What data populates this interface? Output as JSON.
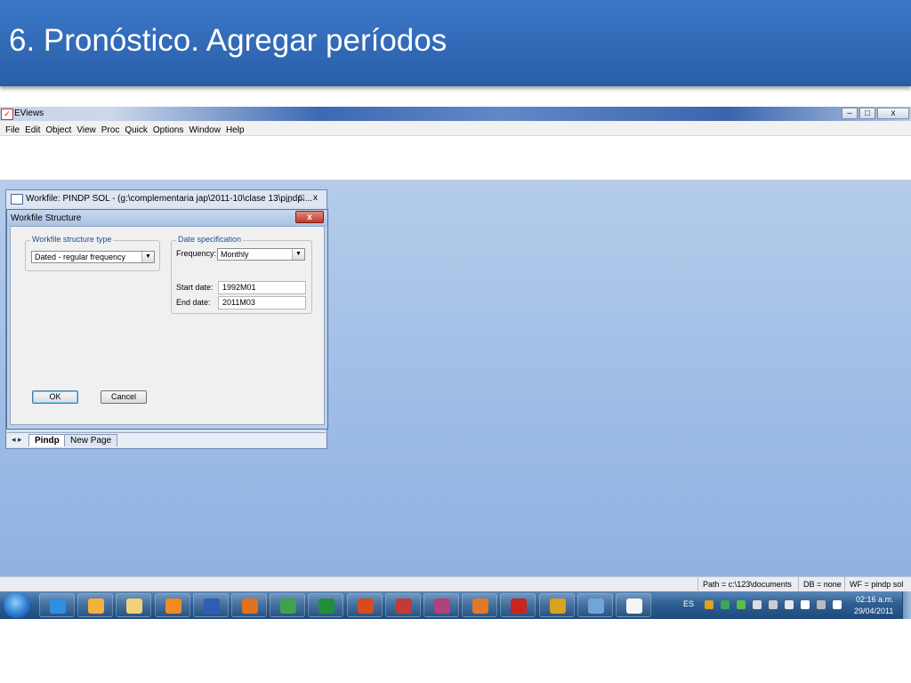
{
  "slide": {
    "title": "6. Pronóstico. Agregar períodos"
  },
  "app": {
    "title": "EViews",
    "icon": "eviews-icon",
    "controls": {
      "minimize": "–",
      "maximize": "□",
      "close": "x"
    }
  },
  "menubar": {
    "items": [
      "File",
      "Edit",
      "Object",
      "View",
      "Proc",
      "Quick",
      "Options",
      "Window",
      "Help"
    ]
  },
  "workfile": {
    "title": "Workfile: PINDP SOL - (g:\\complementaria jap\\2011-10\\clase 13\\pindp....",
    "controls": {
      "minimize": "_",
      "maximize": "□",
      "close": "x"
    },
    "tab_nav": "◂ ▸",
    "tabs": [
      "Pindp",
      "New Page"
    ]
  },
  "dialog": {
    "title": "Workfile Structure",
    "close": "x",
    "structure_group": {
      "legend": "Workfile structure type",
      "selected": "Dated - regular frequency"
    },
    "date_group": {
      "legend": "Date specification",
      "frequency_label": "Frequency:",
      "frequency_value": "Monthly",
      "start_label": "Start date:",
      "start_value": "1992M01",
      "end_label": "End date:",
      "end_value": "2011M03"
    },
    "buttons": {
      "ok": "OK",
      "cancel": "Cancel"
    }
  },
  "statusbar": {
    "path": "Path = c:\\123\\documents",
    "db": "DB = none",
    "wf": "WF = pindp sol"
  },
  "taskbar": {
    "language": "ES",
    "clock_time": "02:16 a.m.",
    "clock_date": "29/04/2011",
    "apps": [
      {
        "name": "internet-explorer-icon",
        "color": "#2f8fe0"
      },
      {
        "name": "outlook-icon",
        "color": "#f3b23b"
      },
      {
        "name": "file-explorer-icon",
        "color": "#f1d27a"
      },
      {
        "name": "media-player-icon",
        "color": "#f08a24"
      },
      {
        "name": "word-icon",
        "color": "#2c5fb3"
      },
      {
        "name": "firefox-icon",
        "color": "#e2701d"
      },
      {
        "name": "chrome-icon",
        "color": "#3fa34d"
      },
      {
        "name": "excel-icon",
        "color": "#1f8f3b"
      },
      {
        "name": "powerpoint-icon",
        "color": "#d64c1e"
      },
      {
        "name": "minitab-icon",
        "color": "#c23a3a"
      },
      {
        "name": "app-flower-icon",
        "color": "#b0407e"
      },
      {
        "name": "matlab-icon",
        "color": "#e07a2a"
      },
      {
        "name": "acrobat-icon",
        "color": "#c8261d"
      },
      {
        "name": "eye-app-icon",
        "color": "#d8a321"
      },
      {
        "name": "paint-icon",
        "color": "#6fa6d9"
      },
      {
        "name": "eviews-icon",
        "color": "#f4f4f4"
      }
    ]
  },
  "colors": {
    "slide_header": "#2e64ad",
    "workspace": "#a3c0e8",
    "dialog_accent": "#1f4f9a",
    "close_red": "#c2392b"
  }
}
